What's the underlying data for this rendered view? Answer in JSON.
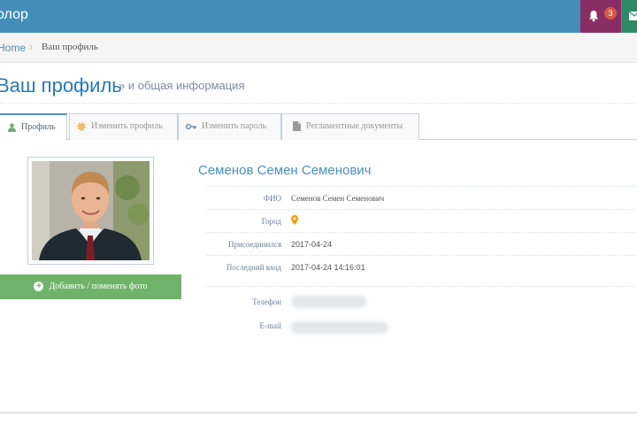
{
  "navbar": {
    "brand": "олор",
    "notification_count": "3",
    "colors": {
      "bar": "#438eb9",
      "notifications": "#892e65",
      "mail": "#2e8965"
    },
    "icons": {
      "notifications": "bell-icon",
      "mail": "envelope-icon"
    }
  },
  "breadcrumbs": {
    "home": "Home",
    "separator": "›",
    "current": "Ваш профиль"
  },
  "page": {
    "title": "Ваш профиль",
    "subtitle": "» и общая информация"
  },
  "tabs": [
    {
      "label": "Профиль",
      "icon": "user-icon",
      "active": true
    },
    {
      "label": "Изменить профиль",
      "icon": "gear-icon",
      "active": false
    },
    {
      "label": "Изменить пароль",
      "icon": "key-icon",
      "active": false
    },
    {
      "label": "Регламентные документы",
      "icon": "document-icon",
      "active": false
    }
  ],
  "profile": {
    "add_photo_label": "Добавить / поменять фото",
    "full_name": "Семенов Семен Семенович",
    "fields": {
      "fio_label": "ФИО",
      "fio_value": "Семенов Семен Семенович",
      "city_label": "Город",
      "city_icon": "map-marker-icon",
      "joined_label": "Присоединился",
      "joined_value": "2017-04-24",
      "last_login_label": "Последний вход",
      "last_login_value": "2017-04-24 14:16:01",
      "phone_label": "Телефон",
      "email_label": "E-mail"
    }
  }
}
